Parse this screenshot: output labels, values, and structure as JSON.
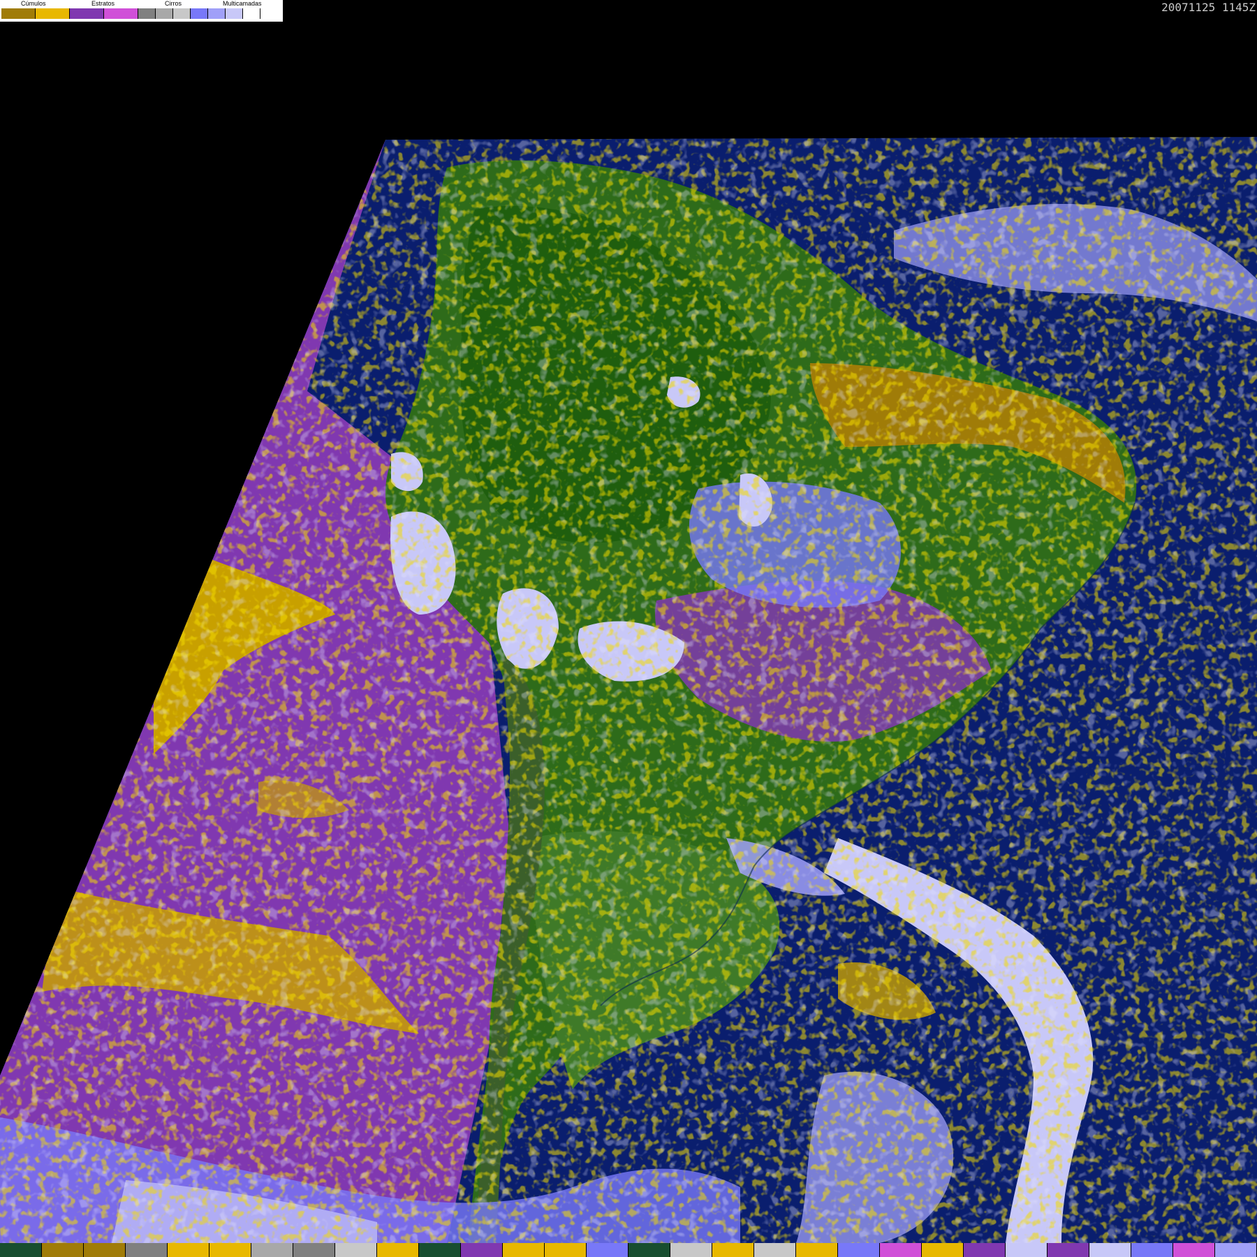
{
  "legend": {
    "labels": {
      "cumulos": "Cúmulos",
      "estratos": "Estratos",
      "cirros": "Cirros",
      "multicamadas": "Multicamadas"
    },
    "swatch_colors": [
      "#a07c08",
      "#e8b800",
      "#8038b0",
      "#d050d8",
      "#808080",
      "#a8a8a8",
      "#c8c8c8",
      "#7878f8",
      "#a0a0f8",
      "#c8c8f8",
      "#ffffff"
    ]
  },
  "timestamp": "20071125 1145Z",
  "colors": {
    "background": "#000000",
    "ocean": "#0a1e6e",
    "land_green": "#2e6b1a",
    "cumulos_dark": "#a07c08",
    "cumulos_light": "#e8b800",
    "estratos_dark": "#8038b0",
    "estratos_light": "#d050d8",
    "cirros": "#a8a8a8",
    "multicamadas_blue": "#7878f8",
    "multicamadas_light": "#c8c8f8"
  },
  "bottom_strip": [
    "#184e30",
    "#a07c08",
    "#a07c08",
    "#808080",
    "#e8b800",
    "#e8b800",
    "#a8a8a8",
    "#808080",
    "#c8c8c8",
    "#e8b800",
    "#184e30",
    "#8038b0",
    "#e8b800",
    "#e8b800",
    "#7878f8",
    "#184e30",
    "#c8c8c8",
    "#e8b800",
    "#c8c8c8",
    "#e8b800",
    "#7878f8",
    "#d050d8",
    "#e8b800",
    "#8038b0",
    "#c8c8f8",
    "#8038b0",
    "#c8c8f8",
    "#7878f8",
    "#d050d8",
    "#a0a0f8"
  ]
}
